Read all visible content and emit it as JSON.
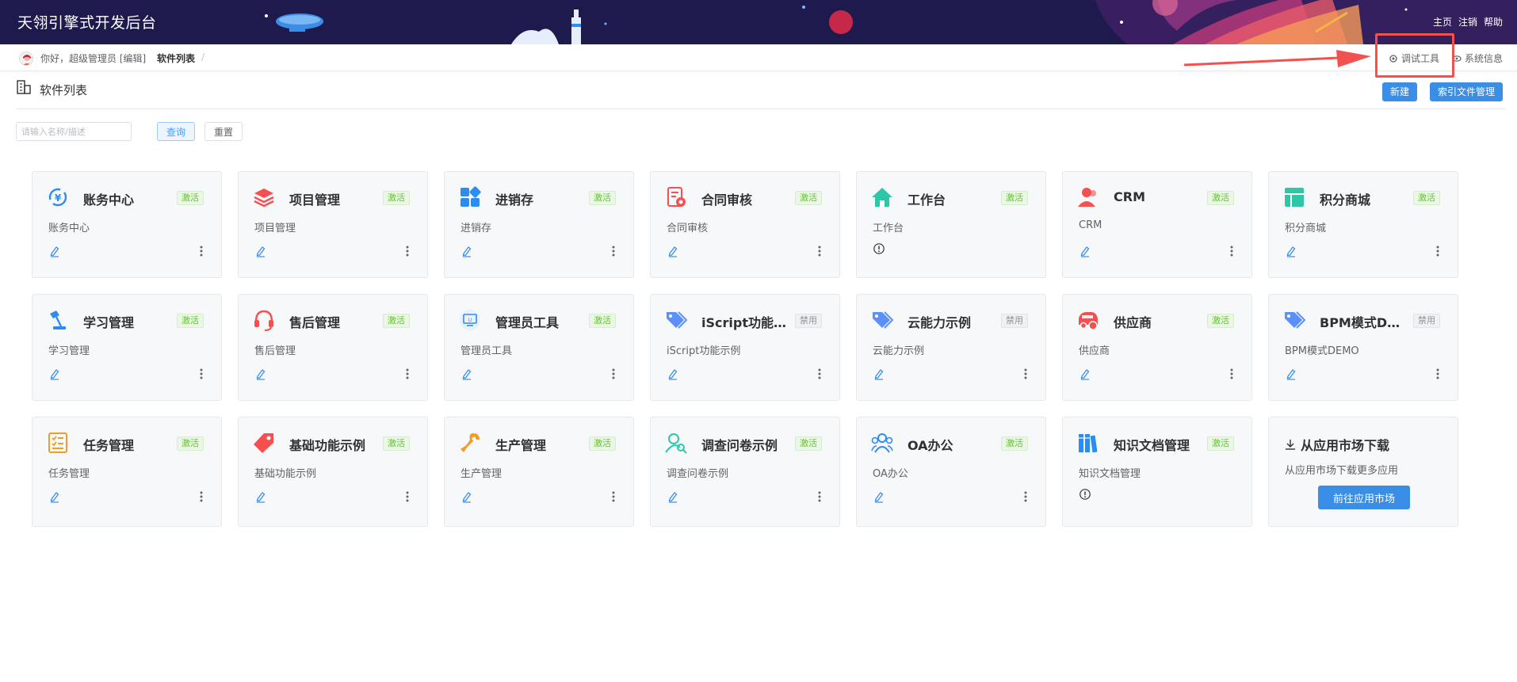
{
  "header": {
    "title": "天翎引擎式开发后台",
    "nav": [
      "主页",
      "注销",
      "帮助"
    ]
  },
  "breadcrumb": {
    "greeting": "你好，超级管理员 [编辑]",
    "current": "软件列表",
    "separator": "/",
    "debug_tool": "调试工具",
    "system_info": "系统信息"
  },
  "page": {
    "title": "软件列表",
    "new_label": "新建",
    "index_label": "索引文件管理",
    "search_placeholder": "请输入名称/描述",
    "query_label": "查询",
    "reset_label": "重置"
  },
  "apps": [
    {
      "name": "账务中心",
      "desc": "账务中心",
      "status": "激活",
      "icon": "yuan-cycle-icon",
      "color": "#2d8cf0"
    },
    {
      "name": "项目管理",
      "desc": "项目管理",
      "status": "激活",
      "icon": "layers-icon",
      "color": "#f5504f"
    },
    {
      "name": "进销存",
      "desc": "进销存",
      "status": "激活",
      "icon": "blocks-icon",
      "color": "#2d8cf0"
    },
    {
      "name": "合同审核",
      "desc": "合同审核",
      "status": "激活",
      "icon": "contract-icon",
      "color": "#f5504f"
    },
    {
      "name": "工作台",
      "desc": "工作台",
      "status": "激活",
      "icon": "home-icon",
      "color": "#2fc6a8"
    },
    {
      "name": "CRM",
      "desc": "CRM",
      "status": "激活",
      "icon": "users-icon",
      "color": "#f5504f"
    },
    {
      "name": "积分商城",
      "desc": "积分商城",
      "status": "激活",
      "icon": "layout-icon",
      "color": "#2fc6a8"
    },
    {
      "name": "学习管理",
      "desc": "学习管理",
      "status": "激活",
      "icon": "desk-lamp-icon",
      "color": "#2d8cf0"
    },
    {
      "name": "售后管理",
      "desc": "售后管理",
      "status": "激活",
      "icon": "headset-icon",
      "color": "#f5504f"
    },
    {
      "name": "管理员工具",
      "desc": "管理员工具",
      "status": "激活",
      "icon": "monitor-icon",
      "color": "#2d8cf0"
    },
    {
      "name": "iScript功能示例",
      "desc": "iScript功能示例",
      "status": "禁用",
      "icon": "tags-icon",
      "color": "#5b8ff9"
    },
    {
      "name": "云能力示例",
      "desc": "云能力示例",
      "status": "禁用",
      "icon": "tags-icon",
      "color": "#5b8ff9"
    },
    {
      "name": "供应商",
      "desc": "供应商",
      "status": "激活",
      "icon": "truck-icon",
      "color": "#f5504f"
    },
    {
      "name": "BPM模式DEMO",
      "desc": "BPM模式DEMO",
      "status": "禁用",
      "icon": "tags-icon",
      "color": "#5b8ff9"
    },
    {
      "name": "任务管理",
      "desc": "任务管理",
      "status": "激活",
      "icon": "checklist-icon",
      "color": "#f59a23"
    },
    {
      "name": "基础功能示例",
      "desc": "基础功能示例",
      "status": "激活",
      "icon": "tag-icon",
      "color": "#f5504f"
    },
    {
      "name": "生产管理",
      "desc": "生产管理",
      "status": "激活",
      "icon": "wrench-icon",
      "color": "#f59a23"
    },
    {
      "name": "调查问卷示例",
      "desc": "调查问卷示例",
      "status": "激活",
      "icon": "user-search-icon",
      "color": "#2fc6a8"
    },
    {
      "name": "OA办公",
      "desc": "OA办公",
      "status": "激活",
      "icon": "team-icon",
      "color": "#2d8cf0"
    },
    {
      "name": "知识文档管理",
      "desc": "知识文档管理",
      "status": "激活",
      "icon": "books-icon",
      "color": "#2d8cf0"
    }
  ],
  "market": {
    "title": "从应用市场下载",
    "desc": "从应用市场下载更多应用",
    "button": "前往应用市场"
  }
}
